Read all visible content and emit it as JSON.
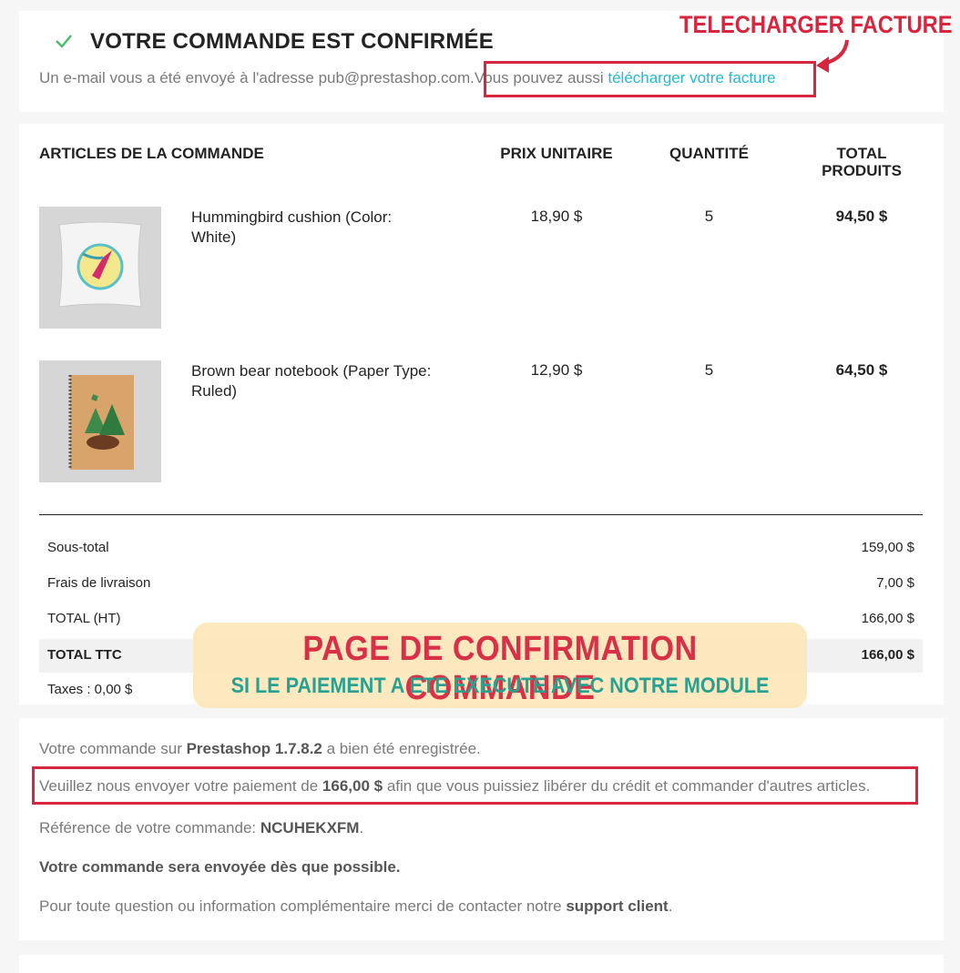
{
  "header": {
    "title": "VOTRE COMMANDE EST CONFIRMÉE",
    "email_text": "Un e-mail vous a été envoyé à l'adresse pub@prestashop.com.",
    "invoice_prefix": "Vous pouvez aussi ",
    "invoice_link": "télécharger votre facture"
  },
  "table": {
    "col_items": "ARTICLES DE LA COMMANDE",
    "col_unit_price": "PRIX UNITAIRE",
    "col_qty": "QUANTITÉ",
    "col_total_1": "TOTAL",
    "col_total_2": "PRODUITS",
    "items": [
      {
        "name": "Hummingbird cushion (Color: White)",
        "unit_price": "18,90 $",
        "qty": "5",
        "total": "94,50 $"
      },
      {
        "name": "Brown bear notebook (Paper Type: Ruled)",
        "unit_price": "12,90 $",
        "qty": "5",
        "total": "64,50 $"
      }
    ]
  },
  "summary": {
    "subtotal_label": "Sous-total",
    "subtotal_value": "159,00 $",
    "shipping_label": "Frais de livraison",
    "shipping_value": "7,00 $",
    "total_ht_label": "TOTAL (HT)",
    "total_ht_value": "166,00 $",
    "total_ttc_label": "TOTAL TTC",
    "total_ttc_value": "166,00 $",
    "taxes": "Taxes : 0,00 $"
  },
  "details": {
    "line1_pre": "Votre commande sur ",
    "line1_shop": "Prestashop 1.7.8.2",
    "line1_post": " a bien été enregistrée.",
    "line2_pre": "Veuillez nous envoyer votre paiement de ",
    "line2_amount": "166,00 $",
    "line2_post": " afin que vous puissiez libérer du crédit et commander d'autres articles.",
    "line3_pre": "Référence de votre commande: ",
    "line3_ref": "NCUHEKXFM",
    "line3_post": ".",
    "line4": "Votre commande sera envoyée dès que possible.",
    "line5_pre": "Pour toute question ou information complémentaire merci de contacter notre ",
    "line5_link": "support client",
    "line5_post": "."
  },
  "annotations": {
    "invoice_callout": "TELECHARGER FACTURE",
    "banner_title": "PAGE DE CONFIRMATION COMMANDE",
    "banner_subtitle": "SI LE PAIEMENT A ETE EXECUTE AVEC NOTRE MODULE"
  },
  "colors": {
    "accent_link": "#24b9d7",
    "annotation_red": "#d7263d",
    "annotation_teal": "#1e9c8c",
    "check_green": "#4cbb6c"
  },
  "icons": [
    "check-icon",
    "arrow-icon"
  ]
}
